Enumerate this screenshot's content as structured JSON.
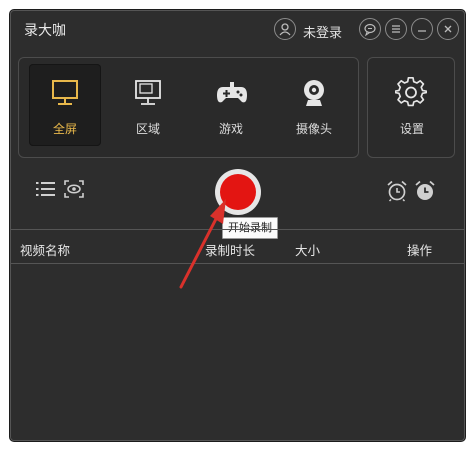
{
  "app": {
    "title": "录大咖"
  },
  "header": {
    "login_label": "未登录"
  },
  "colors": {
    "accent": "#e8b84b",
    "record": "#e31512",
    "background": "#2d2d2d"
  },
  "modes": [
    {
      "label": "全屏",
      "icon": "monitor-icon",
      "active": true
    },
    {
      "label": "区域",
      "icon": "region-icon",
      "active": false
    },
    {
      "label": "游戏",
      "icon": "gamepad-icon",
      "active": false
    },
    {
      "label": "摄像头",
      "icon": "webcam-icon",
      "active": false
    }
  ],
  "settings": {
    "label": "设置",
    "icon": "gear-icon"
  },
  "record": {
    "tooltip": "开始录制"
  },
  "table": {
    "columns": [
      "视频名称",
      "录制时长",
      "大小",
      "操作"
    ]
  }
}
